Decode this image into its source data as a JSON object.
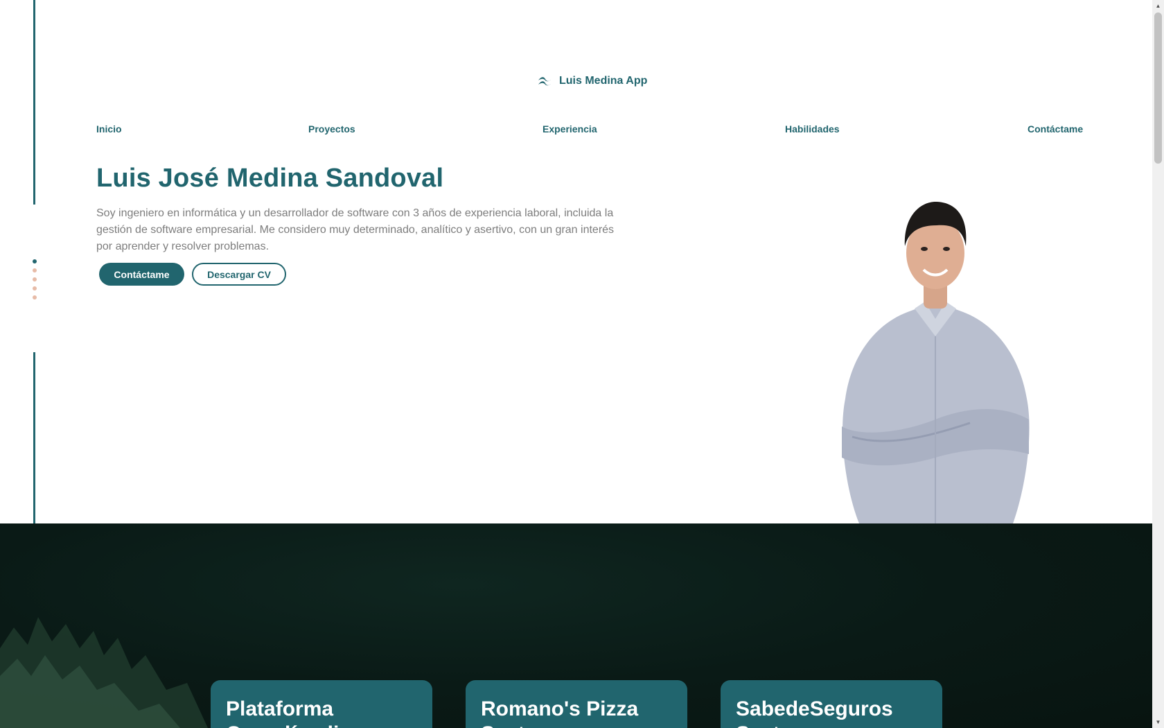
{
  "brand": {
    "name": "Luis Medina App",
    "icon": "tailwind-wave-icon"
  },
  "nav": {
    "items": [
      {
        "label": "Inicio"
      },
      {
        "label": "Proyectos"
      },
      {
        "label": "Experiencia"
      },
      {
        "label": "Habilidades"
      },
      {
        "label": "Contáctame"
      }
    ]
  },
  "hero": {
    "title": "Luis José Medina Sandoval",
    "description": "Soy ingeniero en informática y un desarrollador de software con 3 años de experiencia laboral, incluida la gestión de software empresarial. Me considero muy determinado, analítico y asertivo, con un gran interés por aprender y resolver problemas.",
    "primary_button": "Contáctame",
    "secondary_button": "Descargar CV"
  },
  "section_dots": {
    "count": 5,
    "active_index": 0
  },
  "projects": {
    "cards": [
      {
        "title": "Plataforma Complíandia"
      },
      {
        "title": "Romano's Pizza System"
      },
      {
        "title": "SabedeSeguros System"
      }
    ]
  },
  "colors": {
    "accent": "#21656e",
    "text_muted": "#7d7d7d",
    "dot_inactive": "#e7bba7",
    "projects_bg": "#0a1a16"
  }
}
